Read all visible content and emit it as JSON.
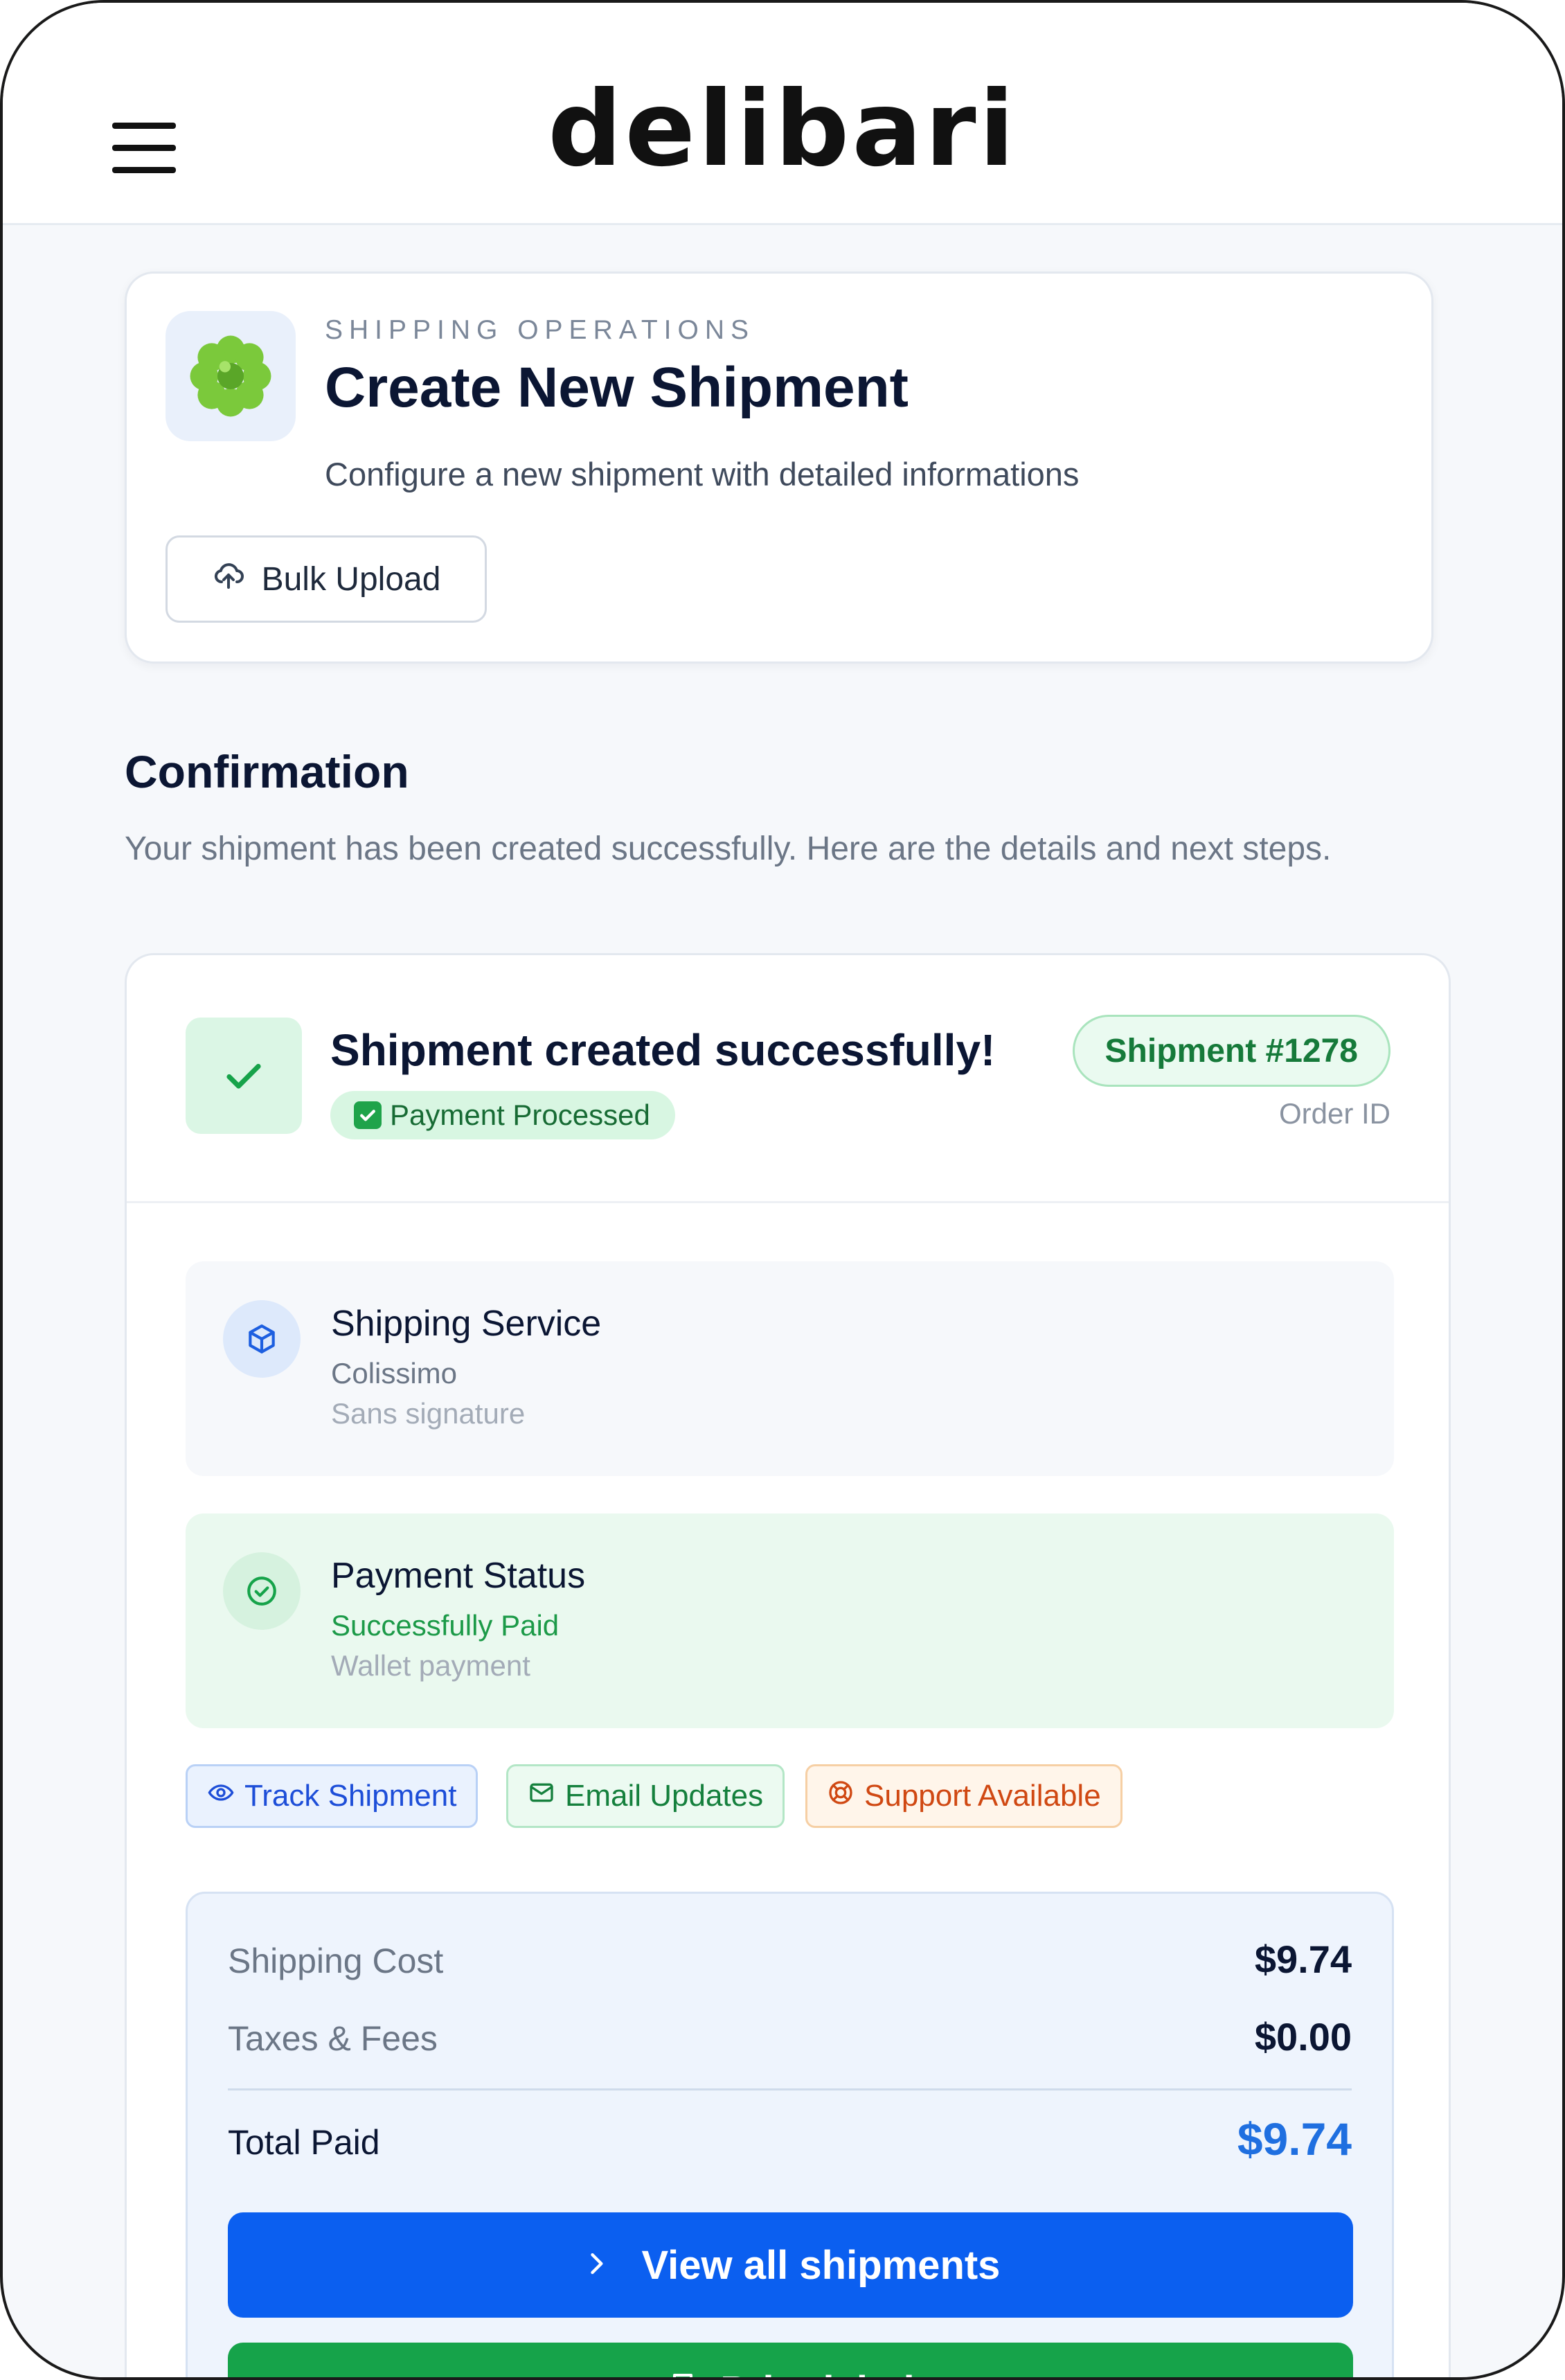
{
  "brand": {
    "logo_text": "delibari"
  },
  "nav": {
    "menu_icon": "hamburger-menu-icon"
  },
  "header": {
    "eyebrow": "SHIPPING OPERATIONS",
    "title": "Create New Shipment",
    "subtitle": "Configure a new shipment with detailed informations",
    "bulk_upload_label": "Bulk Upload",
    "bulk_upload_icon": "cloud-upload-icon",
    "app_icon": "green-flower-icon"
  },
  "confirmation": {
    "title": "Confirmation",
    "subtitle": "Your shipment has been created successfully. Here are the details and next steps."
  },
  "result": {
    "success_title": "Shipment created successfully!",
    "payment_pill": "Payment Processed",
    "shipment_badge": "Shipment #1278",
    "order_id_label": "Order ID"
  },
  "shipping_service": {
    "title": "Shipping Service",
    "carrier": "Colissimo",
    "option": "Sans signature",
    "icon": "package-icon"
  },
  "payment_status": {
    "title": "Payment Status",
    "status": "Successfully Paid",
    "method": "Wallet payment",
    "icon": "check-circle-icon"
  },
  "chips": {
    "track": "Track Shipment",
    "email": "Email Updates",
    "support": "Support Available"
  },
  "summary": {
    "shipping_cost_label": "Shipping Cost",
    "shipping_cost_value": "$9.74",
    "taxes_label": "Taxes & Fees",
    "taxes_value": "$0.00",
    "total_label": "Total Paid",
    "total_value": "$9.74"
  },
  "actions": {
    "view_all_label": "View all shipments",
    "print_label": "Print label"
  },
  "colors": {
    "primary": "#0b5ff0",
    "success": "#16a34a",
    "warning": "#d04812",
    "text": "#0b1633"
  }
}
